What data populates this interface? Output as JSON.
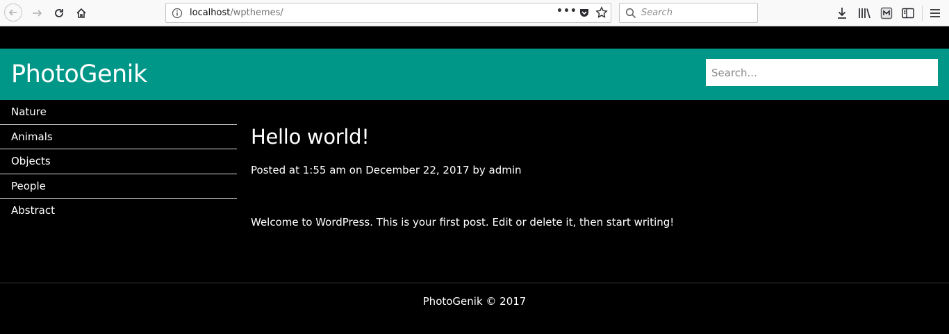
{
  "browser": {
    "url_host": "localhost",
    "url_path": "/wpthemes/",
    "search_placeholder": "Search",
    "more_label": "•••"
  },
  "site": {
    "title": "PhotoGenik",
    "search_placeholder": "Search..."
  },
  "nav": {
    "items": [
      "Nature",
      "Animals",
      "Objects",
      "People",
      "Abstract"
    ]
  },
  "post": {
    "title": "Hello world!",
    "meta": "Posted at 1:55 am on December 22, 2017 by admin",
    "body": "Welcome to WordPress. This is your first post. Edit or delete it, then start writing!"
  },
  "footer": {
    "text": "PhotoGenik © 2017"
  },
  "colors": {
    "header_bg": "#009688",
    "page_bg": "#000000",
    "text": "#ffffff"
  }
}
